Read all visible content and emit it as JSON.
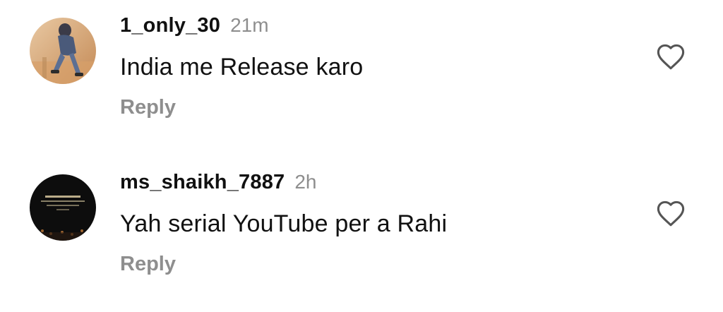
{
  "comments": [
    {
      "username": "1_only_30",
      "time": "21m",
      "text": "India me Release karo",
      "reply_label": "Reply",
      "like_icon": "heart-outline-icon"
    },
    {
      "username": "ms_shaikh_7887",
      "time": "2h",
      "text": "Yah serial YouTube per a Rahi",
      "reply_label": "Reply",
      "like_icon": "heart-outline-icon"
    }
  ],
  "colors": {
    "text_primary": "#111111",
    "text_secondary": "#8e8e8e",
    "background": "#ffffff"
  }
}
